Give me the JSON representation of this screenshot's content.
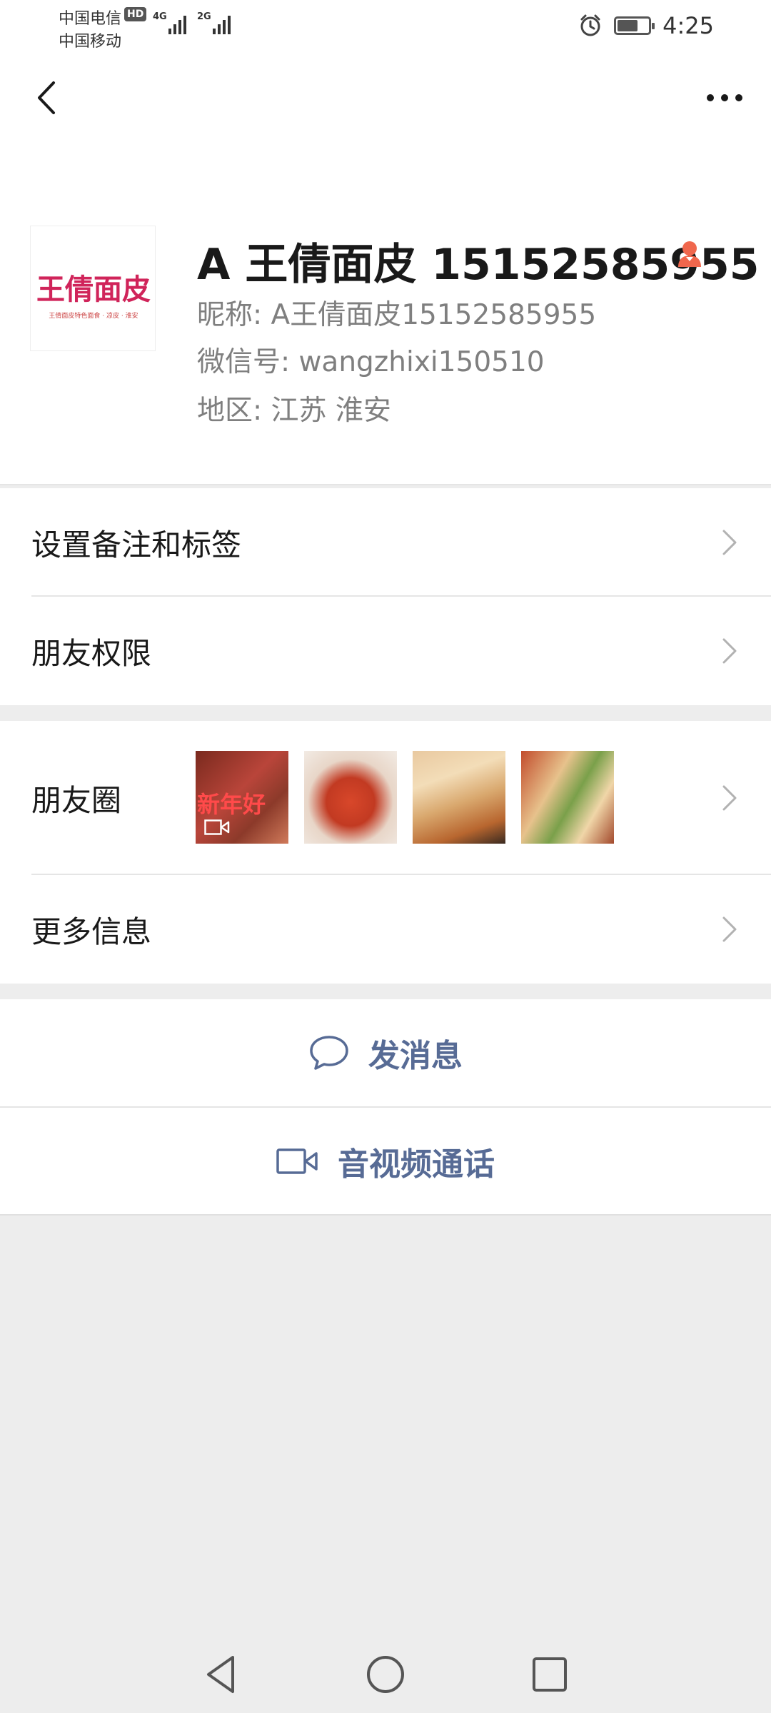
{
  "status_bar": {
    "carrier_1": "中国电信",
    "carrier_1_badge": "HD",
    "carrier_2": "中国移动",
    "net_1": "4G",
    "net_2": "2G",
    "time": "4:25",
    "battery_level": 0.7,
    "icons": [
      "alarm-icon",
      "battery-icon"
    ]
  },
  "header": {
    "back_icon": "chevron-left-icon",
    "more_icon": "more-dots-icon"
  },
  "profile": {
    "display_name": "A 王倩面皮 15152585955",
    "nickname": "昵称:  A王倩面皮15152585955",
    "wechat_id": "微信号:  wangzhixi150510",
    "region": "地区:  江苏  淮安",
    "avatar_text": "王倩面皮",
    "avatar_subtext": "王倩面皮特色面食 · 凉皮 · 淮安",
    "badge_icon": "user-badge-icon",
    "badge_color": "#f0674d"
  },
  "menu": {
    "remarks_label": "设置备注和标签",
    "permissions_label": "朋友权限",
    "moments_label": "朋友圈",
    "more_info_label": "更多信息",
    "moments_thumbs": [
      {
        "caption": "新年好",
        "is_video": true
      },
      {
        "caption": "",
        "is_video": false
      },
      {
        "caption": "",
        "is_video": false
      },
      {
        "caption": "",
        "is_video": false
      }
    ]
  },
  "actions": {
    "message_label": "发消息",
    "call_label": "音视频通话",
    "accent_color": "#576b95"
  },
  "system_nav": {
    "icons": [
      "back-triangle-icon",
      "home-circle-icon",
      "recents-square-icon"
    ]
  }
}
